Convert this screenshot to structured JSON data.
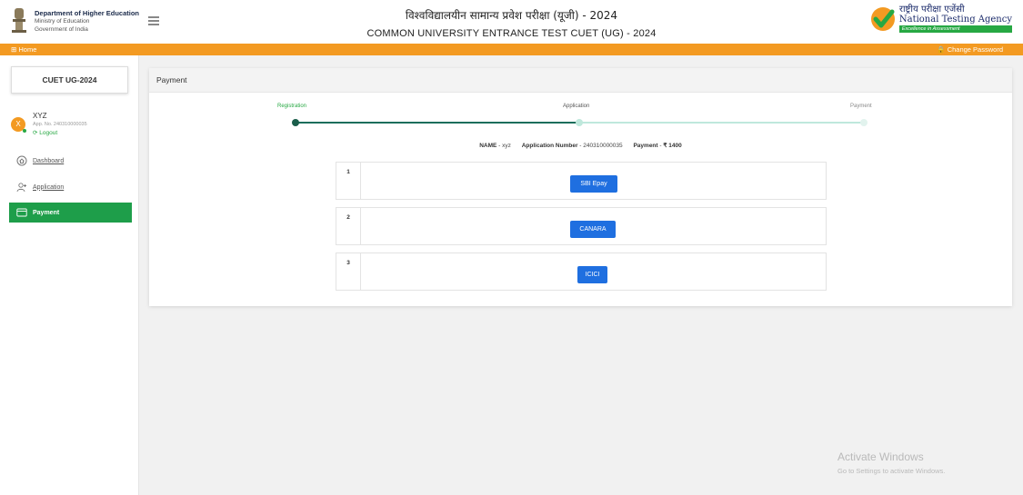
{
  "header": {
    "dept_line1": "Department of Higher Education",
    "dept_line2": "Ministry of Education",
    "dept_line3": "Government of India",
    "title_hindi": "विश्वविद्यालयीन सामान्य प्रवेश परीक्षा (यूजी) - 2024",
    "title_english": "COMMON UNIVERSITY ENTRANCE TEST CUET (UG) - 2024",
    "nta_hindi": "राष्ट्रीय परीक्षा एजेंसी",
    "nta_english": "National Testing Agency",
    "nta_tagline": "Excellence in Assessment"
  },
  "topbar": {
    "home_label": "⊞ Home",
    "change_password_label": "🔒 Change Password"
  },
  "sidebar": {
    "exam_title": "CUET UG-2024",
    "user": {
      "initial": "X",
      "name": "XYZ",
      "app_no": "App. No. 240310000035",
      "logout": "⟳ Logout"
    },
    "nav": [
      {
        "label": "Dashboard"
      },
      {
        "label": "Application"
      },
      {
        "label": "Payment"
      }
    ]
  },
  "main": {
    "card_title": "Payment",
    "steps": [
      {
        "label": "Registration",
        "state": "done"
      },
      {
        "label": "Application",
        "state": "current"
      },
      {
        "label": "Payment",
        "state": "pending"
      }
    ],
    "info": {
      "name_label": "NAME",
      "name_value": "xyz",
      "appno_label": "Application Number",
      "appno_value": "240310000035",
      "payment_label": "Payment",
      "payment_value": "₹ 1400"
    },
    "options": [
      {
        "num": "1",
        "button": "SBI Epay"
      },
      {
        "num": "2",
        "button": "CANARA"
      },
      {
        "num": "3",
        "button": "ICICI"
      }
    ]
  },
  "watermark": {
    "line1": "Activate Windows",
    "line2": "Go to Settings to activate Windows."
  },
  "colors": {
    "orange": "#f39a22",
    "green": "#1e9e4a",
    "teal": "#1b6e5b",
    "blue_button": "#1f6fe0"
  }
}
